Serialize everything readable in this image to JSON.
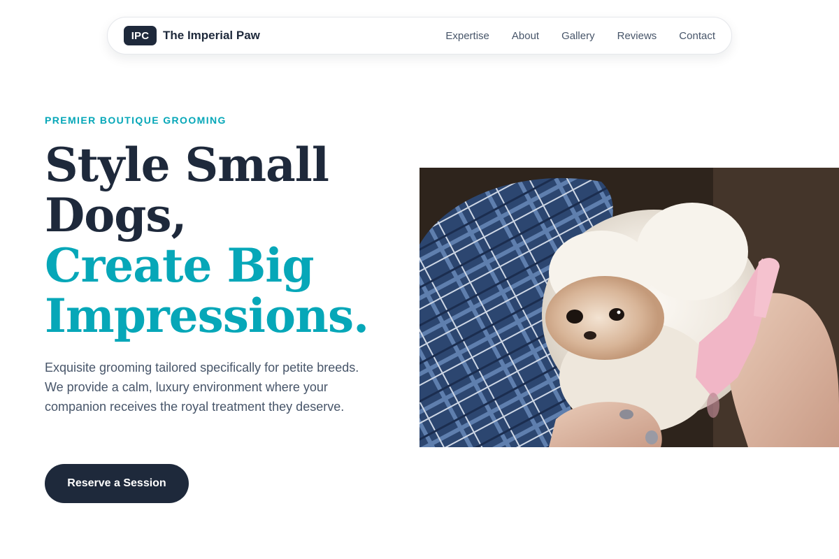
{
  "nav": {
    "logo_badge": "IPC",
    "brand_name": "The Imperial Paw",
    "links": [
      "Expertise",
      "About",
      "Gallery",
      "Reviews",
      "Contact"
    ]
  },
  "hero": {
    "eyebrow": "PREMIER BOUTIQUE GROOMING",
    "headline": {
      "line1": "Style Small",
      "line2": "Dogs,",
      "line3": "Create Big",
      "line4": "Impressions."
    },
    "description": "Exquisite grooming tailored specifically for petite breeds. We provide a calm, luxury environment where your companion receives the royal treatment they deserve.",
    "cta_label": "Reserve a Session",
    "image_icon": "dog-photo-icon"
  },
  "colors": {
    "primary_dark": "#1e293b",
    "accent_teal": "#06a7b8",
    "body_text": "#475569"
  }
}
